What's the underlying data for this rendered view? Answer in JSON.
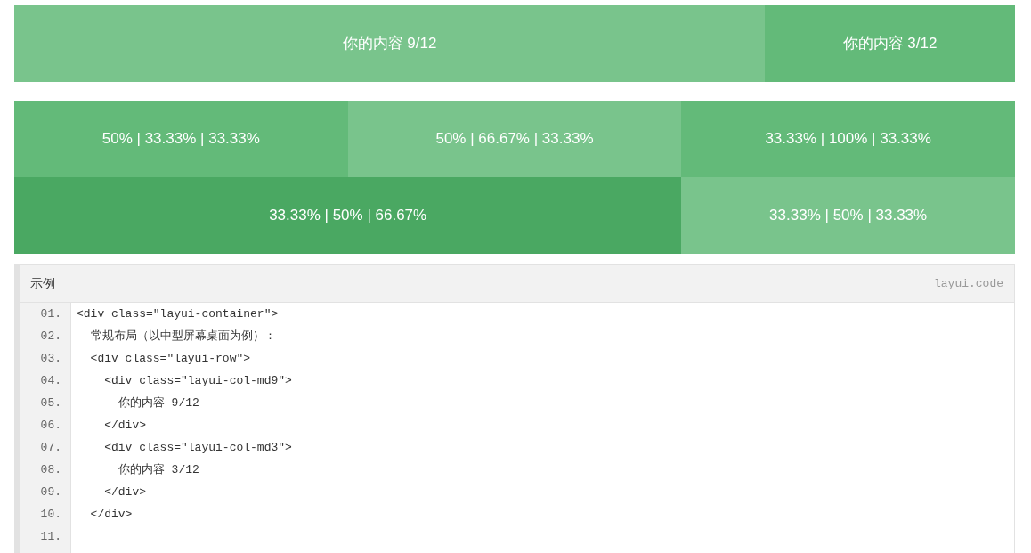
{
  "grid_rows": [
    {
      "cells": [
        {
          "text": "你的内容 9/12",
          "color": "#79c48c"
        },
        {
          "text": "你的内容 3/12",
          "color": "#63ba79"
        }
      ]
    },
    {
      "cells": [
        {
          "text": "50% | 33.33% | 33.33%",
          "color": "#63ba79"
        },
        {
          "text": "50% | 66.67% | 33.33%",
          "color": "#79c48c"
        },
        {
          "text": "33.33% | 100% | 33.33%",
          "color": "#63ba79"
        }
      ]
    },
    {
      "cells": [
        {
          "text": "33.33% | 50% | 66.67%",
          "color": "#4aa862"
        },
        {
          "text": "33.33% | 50% | 33.33%",
          "color": "#79c48c"
        }
      ]
    }
  ],
  "code_block": {
    "title": "示例",
    "language_label": "layui.code",
    "lines": [
      {
        "number": "01.",
        "text": "<div class=\"layui-container\">"
      },
      {
        "number": "02.",
        "text": "  常规布局（以中型屏幕桌面为例）："
      },
      {
        "number": "03.",
        "text": "  <div class=\"layui-row\">"
      },
      {
        "number": "04.",
        "text": "    <div class=\"layui-col-md9\">"
      },
      {
        "number": "05.",
        "text": "      你的内容 9/12"
      },
      {
        "number": "06.",
        "text": "    </div>"
      },
      {
        "number": "07.",
        "text": "    <div class=\"layui-col-md3\">"
      },
      {
        "number": "08.",
        "text": "      你的内容 3/12"
      },
      {
        "number": "09.",
        "text": "    </div>"
      },
      {
        "number": "10.",
        "text": "  </div>"
      },
      {
        "number": "11."
      }
    ]
  }
}
